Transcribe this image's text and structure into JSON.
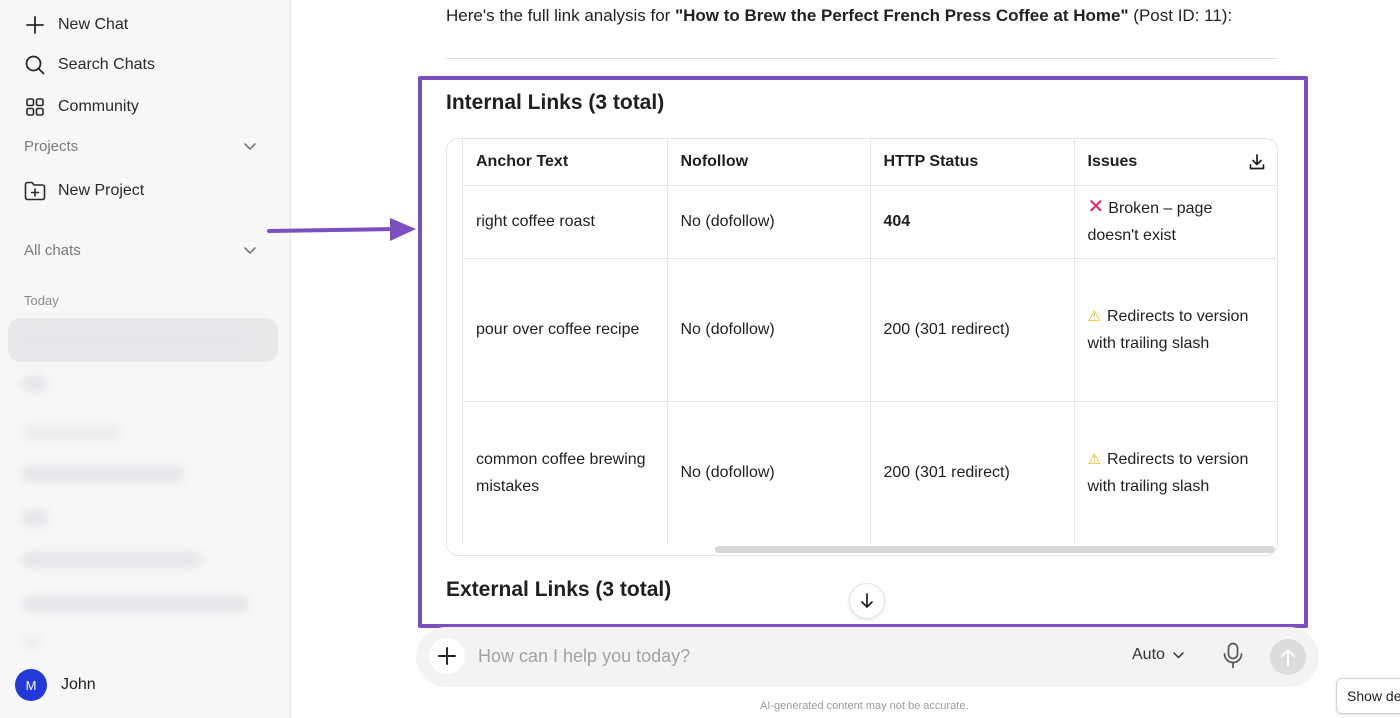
{
  "sidebar": {
    "new_chat": "New Chat",
    "search_chats": "Search Chats",
    "community": "Community",
    "projects": "Projects",
    "new_project": "New Project",
    "all_chats": "All chats",
    "today": "Today",
    "user": {
      "initial": "M",
      "name": "John"
    }
  },
  "main": {
    "intro_prefix": "Here's the full link analysis for ",
    "intro_title": "\"How to Brew the Perfect French Press Coffee at Home\"",
    "intro_suffix": " (Post ID: 11):",
    "internal_heading": "Internal Links (3 total)",
    "external_heading": "External Links (3 total)",
    "table": {
      "headers": [
        "Anchor Text",
        "Nofollow",
        "HTTP Status",
        "Issues"
      ],
      "rows": [
        {
          "anchor": "right coffee roast",
          "nofollow": "No (dofollow)",
          "status": "404",
          "issue_icon": "cross-mark",
          "issue": "Broken – page doesn't exist"
        },
        {
          "anchor": "pour over coffee recipe",
          "nofollow": "No (dofollow)",
          "status": "200 (301 redirect)",
          "issue_icon": "warning",
          "issue": "Redirects to version with trailing slash"
        },
        {
          "anchor": "common coffee brewing mistakes",
          "nofollow": "No (dofollow)",
          "status": "200 (301 redirect)",
          "issue_icon": "warning",
          "issue": "Redirects to version with trailing slash"
        }
      ]
    }
  },
  "composer": {
    "placeholder": "How can I help you today?",
    "model": "Auto"
  },
  "footer": {
    "disclaimer": "AI-generated content may not be accurate.",
    "show_button": "Show des"
  },
  "colors": {
    "highlight": "#7b4fc0",
    "avatar": "#2238d8",
    "error": "#e0245e",
    "warning": "#f4b400"
  }
}
